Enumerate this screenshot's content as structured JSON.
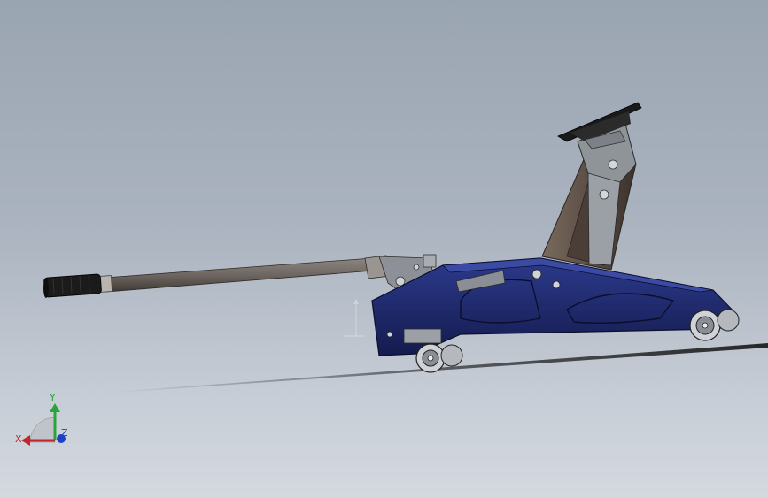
{
  "viewport": {
    "background_top": "#9aa5b2",
    "background_bottom": "#d4d9e0"
  },
  "model": {
    "body_color": "#1f2a6e",
    "handle_color": "#6e6660",
    "grip_color": "#1a1a1a",
    "arm_color": "#5a4a40",
    "saddle_color": "#222222"
  },
  "triad": {
    "x_label": "X",
    "y_label": "Y",
    "z_label": "Z",
    "x_color": "#c0262d",
    "y_color": "#2aa33a",
    "z_color": "#1f3fc6"
  }
}
